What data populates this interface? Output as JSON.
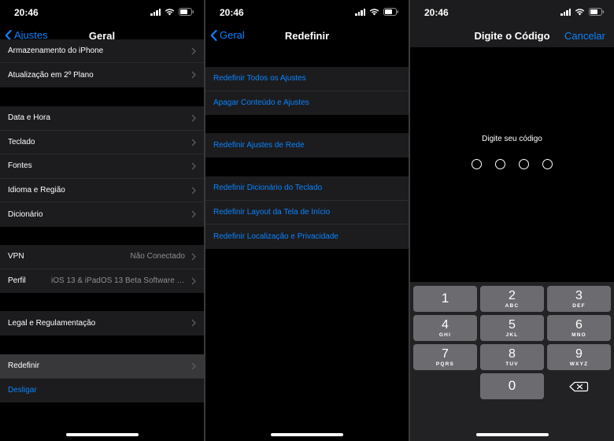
{
  "status": {
    "time": "20:46"
  },
  "screen1": {
    "back_label": "Ajustes",
    "title": "Geral",
    "groups": [
      {
        "rows": [
          {
            "label": "Armazenamento do iPhone"
          },
          {
            "label": "Atualização em 2º Plano"
          }
        ]
      },
      {
        "rows": [
          {
            "label": "Data e Hora"
          },
          {
            "label": "Teclado"
          },
          {
            "label": "Fontes"
          },
          {
            "label": "Idioma e Região"
          },
          {
            "label": "Dicionário"
          }
        ]
      },
      {
        "rows": [
          {
            "label": "VPN",
            "value": "Não Conectado"
          },
          {
            "label": "Perfil",
            "value": "iOS 13 & iPadOS 13 Beta Software Profile..."
          }
        ]
      },
      {
        "rows": [
          {
            "label": "Legal e Regulamentação"
          }
        ]
      },
      {
        "rows": [
          {
            "label": "Redefinir"
          },
          {
            "label": "Desligar"
          }
        ]
      }
    ]
  },
  "screen2": {
    "back_label": "Geral",
    "title": "Redefinir",
    "groups": [
      {
        "rows": [
          {
            "label": "Redefinir Todos os Ajustes"
          },
          {
            "label": "Apagar Conteúdo e Ajustes"
          }
        ]
      },
      {
        "rows": [
          {
            "label": "Redefinir Ajustes de Rede"
          }
        ]
      },
      {
        "rows": [
          {
            "label": "Redefinir Dicionário do Teclado"
          },
          {
            "label": "Redefinir Layout da Tela de Início"
          },
          {
            "label": "Redefinir Localização e Privacidade"
          }
        ]
      }
    ]
  },
  "screen3": {
    "title": "Digite o Código",
    "cancel_label": "Cancelar",
    "prompt": "Digite seu código",
    "keys": [
      {
        "digit": "1",
        "letters": ""
      },
      {
        "digit": "2",
        "letters": "ABC"
      },
      {
        "digit": "3",
        "letters": "DEF"
      },
      {
        "digit": "4",
        "letters": "GHI"
      },
      {
        "digit": "5",
        "letters": "JKL"
      },
      {
        "digit": "6",
        "letters": "MNO"
      },
      {
        "digit": "7",
        "letters": "PQRS"
      },
      {
        "digit": "8",
        "letters": "TUV"
      },
      {
        "digit": "9",
        "letters": "WXYZ"
      },
      {
        "digit": "0",
        "letters": ""
      }
    ]
  }
}
